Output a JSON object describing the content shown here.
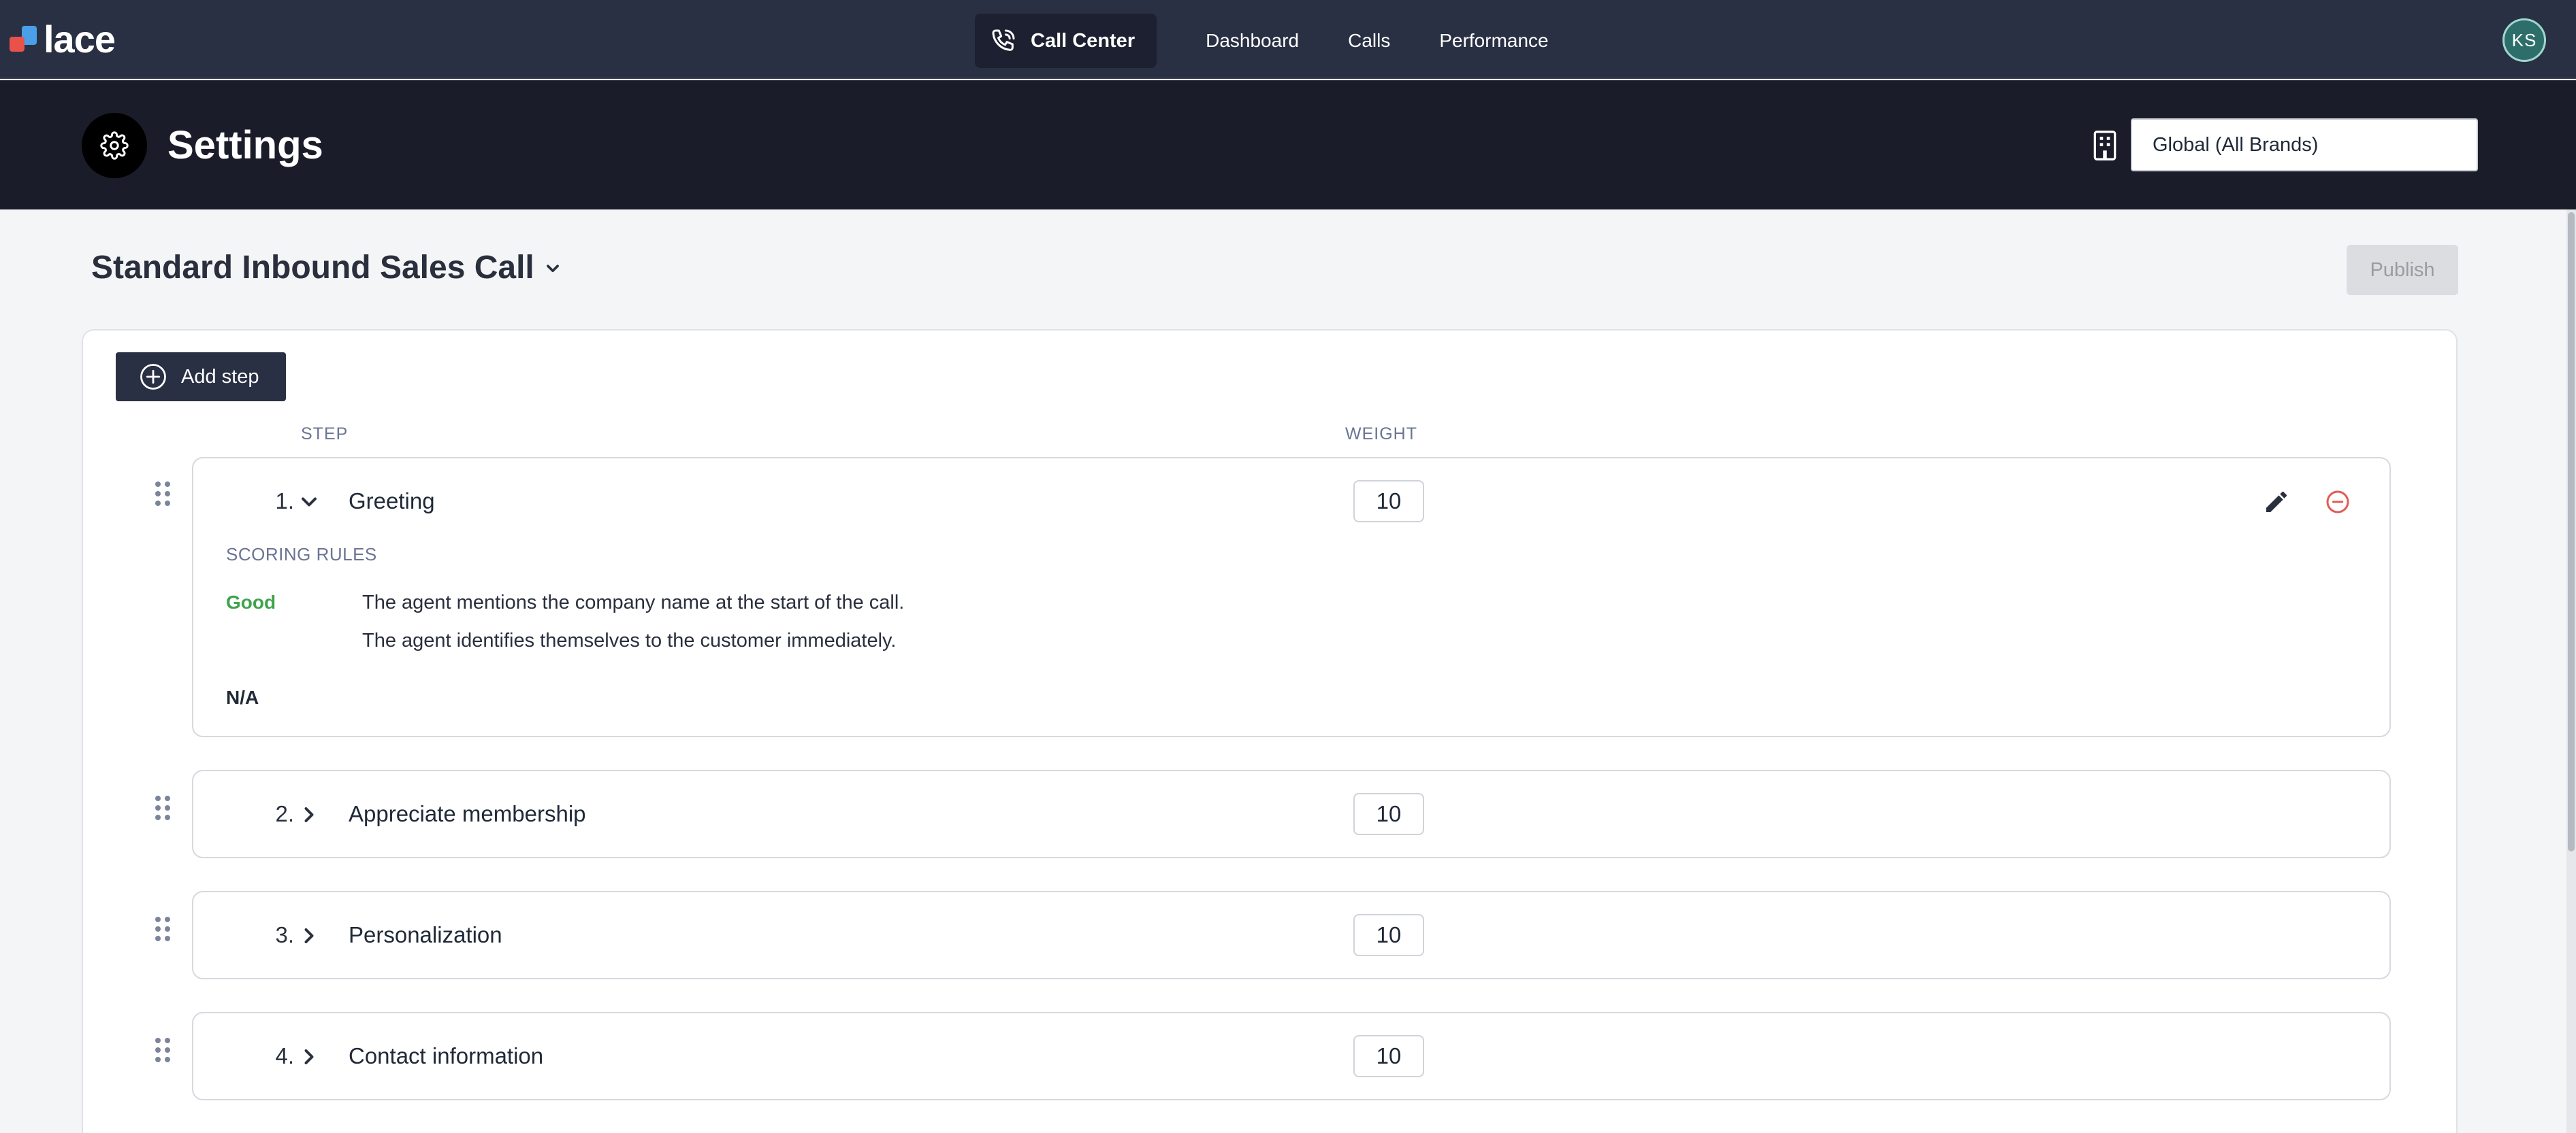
{
  "app": {
    "logo_text": "lace"
  },
  "nav": {
    "active_label": "Call Center",
    "links": [
      "Dashboard",
      "Calls",
      "Performance"
    ]
  },
  "user": {
    "initials": "KS"
  },
  "header": {
    "title": "Settings",
    "brand_select_value": "Global (All Brands)"
  },
  "script": {
    "name": "Standard Inbound Sales Call",
    "publish_label": "Publish",
    "add_step_label": "Add step",
    "col_step": "STEP",
    "col_weight": "WEIGHT"
  },
  "steps": [
    {
      "number": "1.",
      "name": "Greeting",
      "weight": "10",
      "expanded": true,
      "scoring_rules_label": "SCORING RULES",
      "good_label": "Good",
      "good_rules": [
        "The agent mentions the company name at the start of the call.",
        "The agent identifies themselves to the customer immediately."
      ],
      "na_label": "N/A"
    },
    {
      "number": "2.",
      "name": "Appreciate membership",
      "weight": "10",
      "expanded": false
    },
    {
      "number": "3.",
      "name": "Personalization",
      "weight": "10",
      "expanded": false
    },
    {
      "number": "4.",
      "name": "Contact information",
      "weight": "10",
      "expanded": false
    }
  ],
  "colors": {
    "nav_bg": "#2a3043",
    "header_bg": "#1a1d29",
    "good": "#3fa34d",
    "remove": "#e25b55"
  }
}
